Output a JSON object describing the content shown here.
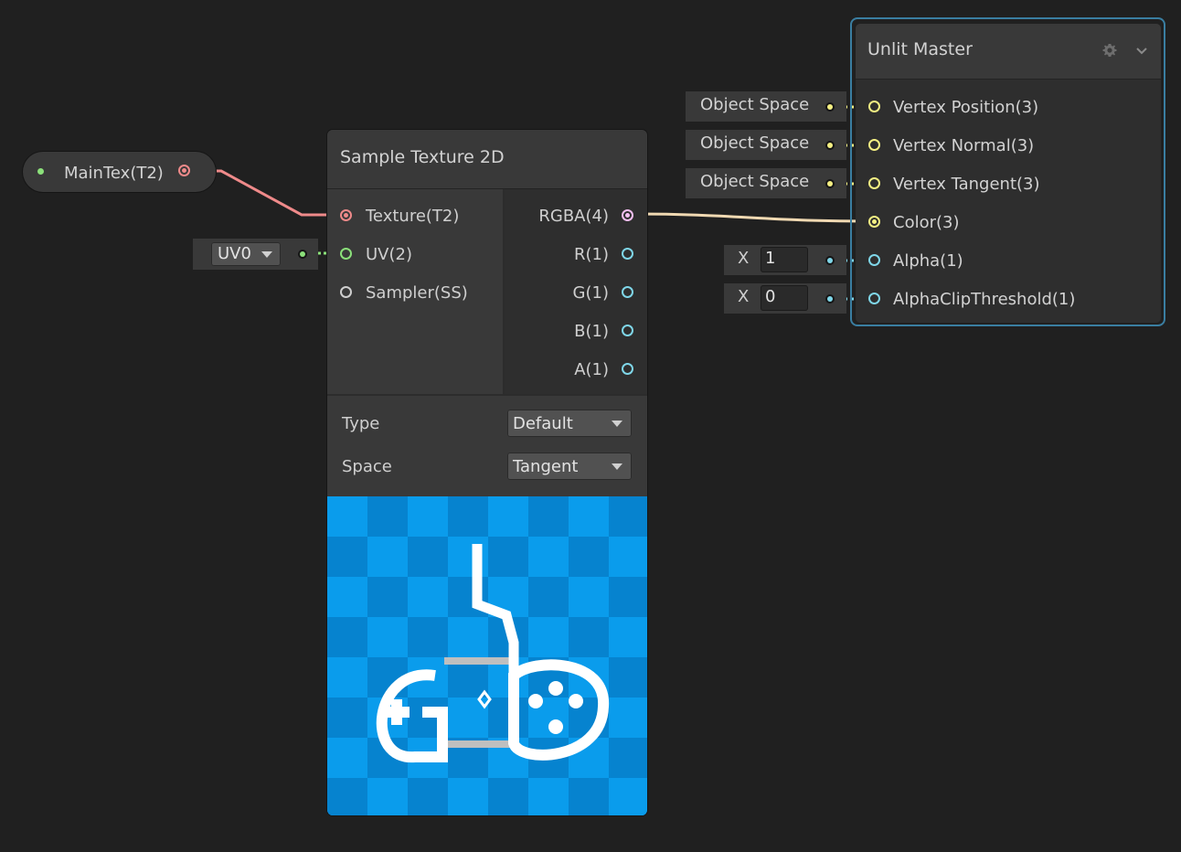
{
  "colors": {
    "texture_port": "#ef8a8a",
    "uv_port": "#8be07a",
    "sampler_port": "#cfcfcf",
    "rgba_port": "#f4bef2",
    "float_port": "#7fd6e8",
    "vector3_port": "#f5f083",
    "selection_outline": "#3a7ea1",
    "preview_checker_light": "#0a9cec",
    "preview_checker_dark": "#0683cf"
  },
  "property_node": {
    "label": "MainTex(T2)"
  },
  "sample_texture": {
    "title": "Sample Texture 2D",
    "inputs": [
      {
        "label": "Texture(T2)"
      },
      {
        "label": "UV(2)"
      },
      {
        "label": "Sampler(SS)"
      }
    ],
    "outputs": [
      {
        "label": "RGBA(4)"
      },
      {
        "label": "R(1)"
      },
      {
        "label": "G(1)"
      },
      {
        "label": "B(1)"
      },
      {
        "label": "A(1)"
      }
    ],
    "settings": {
      "type_label": "Type",
      "type_value": "Default",
      "space_label": "Space",
      "space_value": "Tangent"
    }
  },
  "uv_input": {
    "value": "UV0"
  },
  "master_inline_inputs": {
    "vertex_position": "Object Space",
    "vertex_normal": "Object Space",
    "vertex_tangent": "Object Space",
    "alpha_axis": "X",
    "alpha_value": "1",
    "alpha_clip_axis": "X",
    "alpha_clip_value": "0"
  },
  "master_node": {
    "title": "Unlit Master",
    "slots": [
      {
        "label": "Vertex Position(3)"
      },
      {
        "label": "Vertex Normal(3)"
      },
      {
        "label": "Vertex Tangent(3)"
      },
      {
        "label": "Color(3)"
      },
      {
        "label": "Alpha(1)"
      },
      {
        "label": "AlphaClipThreshold(1)"
      }
    ]
  }
}
